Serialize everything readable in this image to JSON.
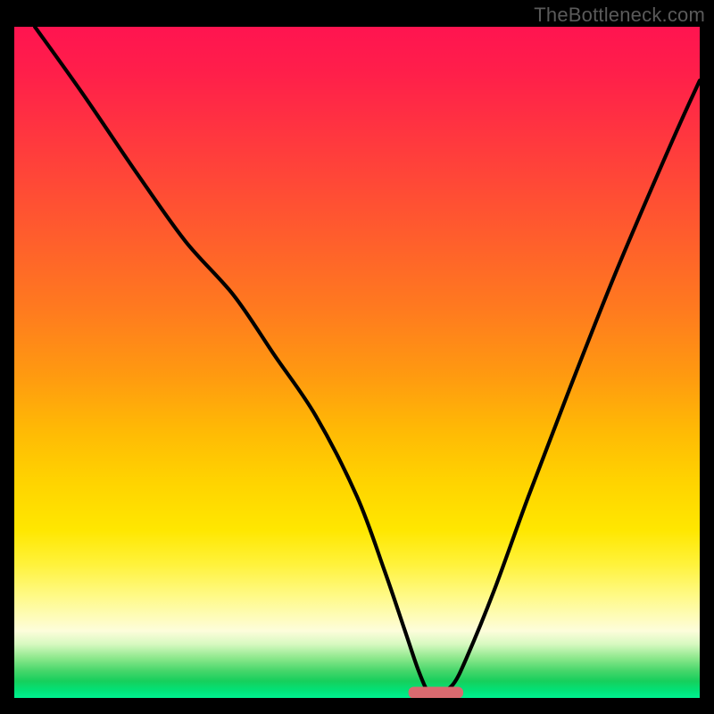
{
  "watermark": "TheBottleneck.com",
  "chart_data": {
    "type": "line",
    "title": "",
    "xlabel": "",
    "ylabel": "",
    "xlim": [
      0,
      100
    ],
    "ylim": [
      0,
      100
    ],
    "x": [
      3,
      10,
      18,
      25,
      32,
      38,
      44,
      50,
      54,
      57,
      59,
      60.5,
      62,
      64,
      66,
      70,
      75,
      81,
      88,
      96,
      100
    ],
    "values": [
      100,
      90,
      78,
      68,
      60,
      51,
      42,
      30,
      19,
      10,
      4,
      0.8,
      0.8,
      2,
      6,
      16,
      30,
      46,
      64,
      83,
      92
    ],
    "marker": {
      "x_center": 61.5,
      "y": 0.8,
      "width": 8
    },
    "gradient_stops": [
      {
        "pos": 0,
        "color": "#ff1450"
      },
      {
        "pos": 50,
        "color": "#ff9a10"
      },
      {
        "pos": 75,
        "color": "#ffe700"
      },
      {
        "pos": 92,
        "color": "#d7f9c0"
      },
      {
        "pos": 100,
        "color": "#00f090"
      }
    ]
  }
}
